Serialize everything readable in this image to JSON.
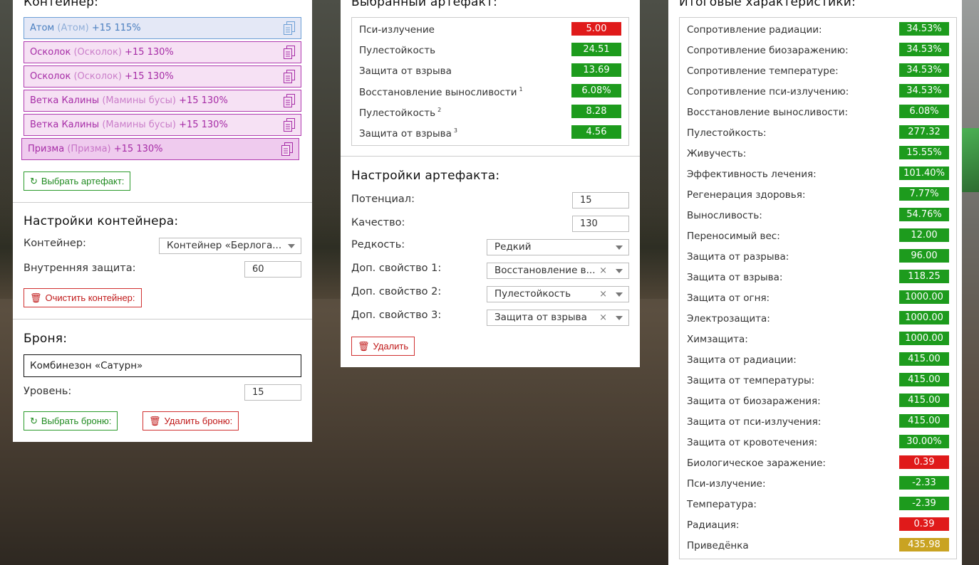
{
  "container": {
    "title": "Контейнер:",
    "artifacts": [
      {
        "name": "Атом",
        "alt": "(Атом)",
        "suffix": "+15 115%",
        "style": "blue"
      },
      {
        "name": "Осколок",
        "alt": "(Осколок)",
        "suffix": "+15 130%",
        "style": "pink"
      },
      {
        "name": "Осколок",
        "alt": "(Осколок)",
        "suffix": "+15 130%",
        "style": "pink"
      },
      {
        "name": "Ветка Калины",
        "alt": "(Мамины бусы)",
        "suffix": "+15 130%",
        "style": "pink"
      },
      {
        "name": "Ветка Калины",
        "alt": "(Мамины бусы)",
        "suffix": "+15 130%",
        "style": "pink"
      },
      {
        "name": "Призма",
        "alt": "(Призма)",
        "suffix": "+15 130%",
        "style": "pink2"
      }
    ],
    "choose_artifact_label": "Выбрать артефакт:",
    "copy_icon": "copy-icon"
  },
  "container_settings": {
    "title": "Настройки контейнера:",
    "container_label": "Контейнер:",
    "container_value": "Контейнер «Берлога...",
    "protection_label": "Внутренняя защита:",
    "protection_value": "60",
    "clear_label": "Очистить контейнер:"
  },
  "armor": {
    "title": "Броня:",
    "name": "Комбинезон «Сатурн»",
    "level_label": "Уровень:",
    "level_value": "15",
    "choose_label": "Выбрать броню:",
    "delete_label": "Удалить броню:"
  },
  "selected_artifact": {
    "title": "Выбранный артефакт:",
    "stats": [
      {
        "name": "Пси-излучение",
        "sup": "",
        "value": "5.00",
        "color": "r"
      },
      {
        "name": "Пулестойкость",
        "sup": "",
        "value": "24.51",
        "color": "g"
      },
      {
        "name": "Защита от взрыва",
        "sup": "",
        "value": "13.69",
        "color": "g"
      },
      {
        "name": "Восстановление выносливости",
        "sup": "1",
        "value": "6.08%",
        "color": "g"
      },
      {
        "name": "Пулестойкость",
        "sup": "2",
        "value": "8.28",
        "color": "g"
      },
      {
        "name": "Защита от взрыва",
        "sup": "3",
        "value": "4.56",
        "color": "g"
      }
    ]
  },
  "artifact_settings": {
    "title": "Настройки артефакта:",
    "potential_label": "Потенциал:",
    "potential_value": "15",
    "quality_label": "Качество:",
    "quality_value": "130",
    "rarity_label": "Редкость:",
    "rarity_value": "Редкий",
    "prop1_label": "Доп. свойство 1:",
    "prop1_value": "Восстановление в...",
    "prop2_label": "Доп. свойство 2:",
    "prop2_value": "Пулестойкость",
    "prop3_label": "Доп. свойство 3:",
    "prop3_value": "Защита от взрыва",
    "clear_glyph": "×",
    "delete_label": "Удалить"
  },
  "totals": {
    "title": "Итоговые характеристики:",
    "stats": [
      {
        "name": "Сопротивление радиации:",
        "value": "34.53%",
        "color": "g"
      },
      {
        "name": "Сопротивление биозаражению:",
        "value": "34.53%",
        "color": "g"
      },
      {
        "name": "Сопротивление температуре:",
        "value": "34.53%",
        "color": "g"
      },
      {
        "name": "Сопротивление пси-излучению:",
        "value": "34.53%",
        "color": "g"
      },
      {
        "name": "Восстановление выносливости:",
        "value": "6.08%",
        "color": "g"
      },
      {
        "name": "Пулестойкость:",
        "value": "277.32",
        "color": "g"
      },
      {
        "name": "Живучесть:",
        "value": "15.55%",
        "color": "g"
      },
      {
        "name": "Эффективность лечения:",
        "value": "101.40%",
        "color": "g"
      },
      {
        "name": "Регенерация здоровья:",
        "value": "7.77%",
        "color": "g"
      },
      {
        "name": "Выносливость:",
        "value": "54.76%",
        "color": "g"
      },
      {
        "name": "Переносимый вес:",
        "value": "12.00",
        "color": "g"
      },
      {
        "name": "Защита от разрыва:",
        "value": "96.00",
        "color": "g"
      },
      {
        "name": "Защита от взрыва:",
        "value": "118.25",
        "color": "g"
      },
      {
        "name": "Защита от огня:",
        "value": "1000.00",
        "color": "g"
      },
      {
        "name": "Электрозащита:",
        "value": "1000.00",
        "color": "g"
      },
      {
        "name": "Химзащита:",
        "value": "1000.00",
        "color": "g"
      },
      {
        "name": "Защита от радиации:",
        "value": "415.00",
        "color": "g"
      },
      {
        "name": "Защита от температуры:",
        "value": "415.00",
        "color": "g"
      },
      {
        "name": "Защита от биозаражения:",
        "value": "415.00",
        "color": "g"
      },
      {
        "name": "Защита от пси-излучения:",
        "value": "415.00",
        "color": "g"
      },
      {
        "name": "Защита от кровотечения:",
        "value": "30.00%",
        "color": "g"
      },
      {
        "name": "Биологическое заражение:",
        "value": "0.39",
        "color": "r"
      },
      {
        "name": "Пси-излучение:",
        "value": "-2.33",
        "color": "g"
      },
      {
        "name": "Температура:",
        "value": "-2.39",
        "color": "g"
      },
      {
        "name": "Радиация:",
        "value": "0.39",
        "color": "r"
      },
      {
        "name": "Приведёнка",
        "value": "435.98",
        "color": "y"
      }
    ]
  },
  "colors": {
    "green": "#1d9b1d",
    "red": "#e01a1a",
    "yellow": "#c9a322",
    "pink_text": "#a62ca6",
    "blue_text": "#4a7fc0"
  }
}
